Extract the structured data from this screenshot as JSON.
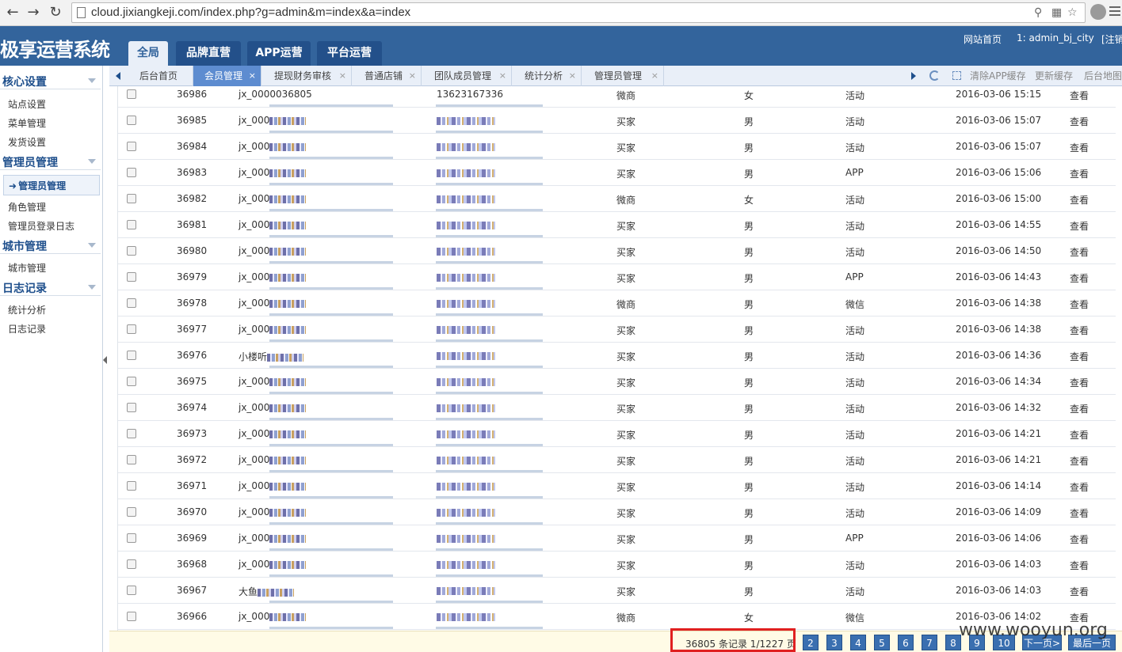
{
  "browser": {
    "url": "cloud.jixiangkeji.com/index.php?g=admin&m=index&a=index"
  },
  "header": {
    "title": "极享运营系统",
    "tabs": [
      {
        "label": "全局",
        "active": true
      },
      {
        "label": "品牌直营",
        "active": false
      },
      {
        "label": "APP运营",
        "active": false
      },
      {
        "label": "平台运营",
        "active": false
      }
    ],
    "site_home": "网站首页",
    "user": "1: admin_bj_city",
    "logout": "[注销"
  },
  "sidebar": {
    "groups": [
      {
        "label": "核心设置",
        "items": [
          "站点设置",
          "菜单管理",
          "发货设置"
        ]
      },
      {
        "label": "管理员管理",
        "items": [
          "管理员管理",
          "角色管理",
          "管理员登录日志"
        ]
      },
      {
        "label": "城市管理",
        "items": [
          "城市管理"
        ]
      },
      {
        "label": "日志记录",
        "items": [
          "统计分析",
          "日志记录"
        ]
      }
    ],
    "active_item": "管理员管理"
  },
  "subtabs": [
    {
      "label": "后台首页",
      "closable": false,
      "active": false
    },
    {
      "label": "会员管理",
      "closable": true,
      "active": true
    },
    {
      "label": "提现财务审核",
      "closable": true,
      "active": false
    },
    {
      "label": "普通店铺",
      "closable": true,
      "active": false
    },
    {
      "label": "团队成员管理",
      "closable": true,
      "active": false
    },
    {
      "label": "统计分析",
      "closable": true,
      "active": false
    },
    {
      "label": "管理员管理",
      "closable": true,
      "active": false
    }
  ],
  "toolbar": {
    "clear_app_cache": "清除APP缓存",
    "update_cache": "更新缓存",
    "backend_map": "后台地图"
  },
  "close_glyph": "×",
  "rows": [
    {
      "id": "36986",
      "user": "jx_0000036805",
      "phone": "13623167336",
      "type": "微商",
      "gender": "女",
      "source": "活动",
      "time": "2016-03-06 15:15",
      "action": "查看",
      "masked": false
    },
    {
      "id": "36985",
      "user": "jx_000",
      "phone": "",
      "type": "买家",
      "gender": "男",
      "source": "活动",
      "time": "2016-03-06 15:07",
      "action": "查看",
      "masked": true
    },
    {
      "id": "36984",
      "user": "jx_000",
      "phone": "",
      "type": "买家",
      "gender": "男",
      "source": "活动",
      "time": "2016-03-06 15:07",
      "action": "查看",
      "masked": true
    },
    {
      "id": "36983",
      "user": "jx_000",
      "phone": "",
      "type": "买家",
      "gender": "男",
      "source": "APP",
      "time": "2016-03-06 15:06",
      "action": "查看",
      "masked": true
    },
    {
      "id": "36982",
      "user": "jx_000",
      "phone": "",
      "type": "微商",
      "gender": "女",
      "source": "活动",
      "time": "2016-03-06 15:00",
      "action": "查看",
      "masked": true
    },
    {
      "id": "36981",
      "user": "jx_000",
      "phone": "",
      "type": "买家",
      "gender": "男",
      "source": "活动",
      "time": "2016-03-06 14:55",
      "action": "查看",
      "masked": true
    },
    {
      "id": "36980",
      "user": "jx_000",
      "phone": "",
      "type": "买家",
      "gender": "男",
      "source": "活动",
      "time": "2016-03-06 14:50",
      "action": "查看",
      "masked": true
    },
    {
      "id": "36979",
      "user": "jx_000",
      "phone": "",
      "type": "买家",
      "gender": "男",
      "source": "APP",
      "time": "2016-03-06 14:43",
      "action": "查看",
      "masked": true
    },
    {
      "id": "36978",
      "user": "jx_000",
      "phone": "",
      "type": "微商",
      "gender": "男",
      "source": "微信",
      "time": "2016-03-06 14:38",
      "action": "查看",
      "masked": true
    },
    {
      "id": "36977",
      "user": "jx_000",
      "phone": "",
      "type": "买家",
      "gender": "男",
      "source": "活动",
      "time": "2016-03-06 14:38",
      "action": "查看",
      "masked": true
    },
    {
      "id": "36976",
      "user": "小楼听",
      "phone": "",
      "type": "买家",
      "gender": "男",
      "source": "活动",
      "time": "2016-03-06 14:36",
      "action": "查看",
      "masked": true
    },
    {
      "id": "36975",
      "user": "jx_000",
      "phone": "",
      "type": "买家",
      "gender": "男",
      "source": "活动",
      "time": "2016-03-06 14:34",
      "action": "查看",
      "masked": true
    },
    {
      "id": "36974",
      "user": "jx_000",
      "phone": "",
      "type": "买家",
      "gender": "男",
      "source": "活动",
      "time": "2016-03-06 14:32",
      "action": "查看",
      "masked": true
    },
    {
      "id": "36973",
      "user": "jx_000",
      "phone": "",
      "type": "买家",
      "gender": "男",
      "source": "活动",
      "time": "2016-03-06 14:21",
      "action": "查看",
      "masked": true
    },
    {
      "id": "36972",
      "user": "jx_000",
      "phone": "",
      "type": "买家",
      "gender": "男",
      "source": "活动",
      "time": "2016-03-06 14:21",
      "action": "查看",
      "masked": true
    },
    {
      "id": "36971",
      "user": "jx_000",
      "phone": "",
      "type": "买家",
      "gender": "男",
      "source": "活动",
      "time": "2016-03-06 14:14",
      "action": "查看",
      "masked": true
    },
    {
      "id": "36970",
      "user": "jx_000",
      "phone": "",
      "type": "买家",
      "gender": "男",
      "source": "活动",
      "time": "2016-03-06 14:09",
      "action": "查看",
      "masked": true
    },
    {
      "id": "36969",
      "user": "jx_000",
      "phone": "",
      "type": "买家",
      "gender": "男",
      "source": "APP",
      "time": "2016-03-06 14:06",
      "action": "查看",
      "masked": true
    },
    {
      "id": "36968",
      "user": "jx_000",
      "phone": "",
      "type": "买家",
      "gender": "男",
      "source": "活动",
      "time": "2016-03-06 14:03",
      "action": "查看",
      "masked": true
    },
    {
      "id": "36967",
      "user": "大鱼",
      "phone": "",
      "type": "买家",
      "gender": "男",
      "source": "活动",
      "time": "2016-03-06 14:03",
      "action": "查看",
      "masked": true
    },
    {
      "id": "36966",
      "user": "jx_000",
      "phone": "",
      "type": "微商",
      "gender": "女",
      "source": "微信",
      "time": "2016-03-06 14:02",
      "action": "查看",
      "masked": true
    }
  ],
  "pager": {
    "summary": "36805 条记录 1/1227 页",
    "pages": [
      "2",
      "3",
      "4",
      "5",
      "6",
      "7",
      "8",
      "9",
      "10"
    ],
    "next": "下一页>",
    "last": "最后一页"
  },
  "watermark": "www.wooyun.org",
  "colors": {
    "header_bg": "#33649c",
    "active_subtab": "#5d8cd0",
    "highlight_border": "#e02020"
  }
}
